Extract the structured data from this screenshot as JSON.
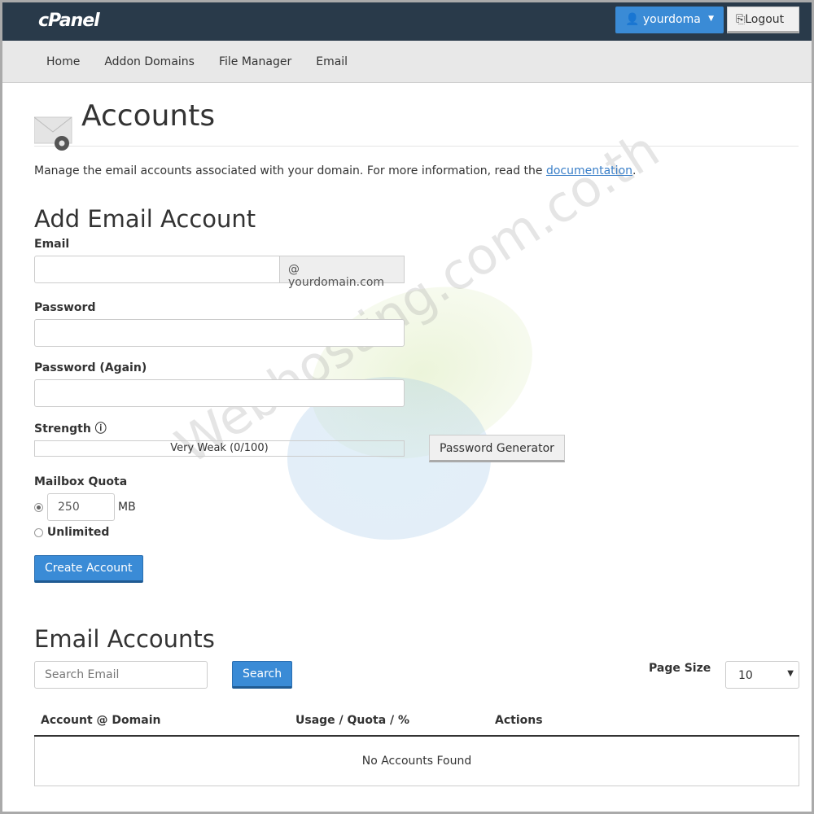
{
  "header": {
    "logo": "cPanel",
    "user_label": "yourdoma",
    "logout_label": "Logout"
  },
  "nav": [
    "Home",
    "Addon Domains",
    "File Manager",
    "Email"
  ],
  "page": {
    "title": "Accounts",
    "description": "Manage the email accounts associated with your domain. For more information, read the ",
    "doc_link": "documentation",
    "desc_end": "."
  },
  "add": {
    "heading": "Add Email Account",
    "email_label": "Email",
    "email_value": "",
    "domain_suffix": "@ yourdomain.com",
    "password_label": "Password",
    "password_again_label": "Password (Again)",
    "strength_label": "Strength",
    "strength_value": "Very Weak (0/100)",
    "strength_percent": 0,
    "generator_label": "Password Generator",
    "quota_label": "Mailbox Quota",
    "quota_value": "250",
    "quota_unit": "MB",
    "unlimited_label": "Unlimited",
    "quota_selected": "limited",
    "create_label": "Create Account"
  },
  "list": {
    "heading": "Email Accounts",
    "search_placeholder": "Search Email",
    "search_label": "Search",
    "page_size_label": "Page Size",
    "page_size_value": "10",
    "columns": [
      "Account @ Domain",
      "Usage / Quota / %",
      "Actions"
    ],
    "empty": "No Accounts Found"
  },
  "watermark": "Webhosting.com.co.th",
  "colors": {
    "topbar": "#293a4a",
    "primary": "#3a8bd6",
    "nav": "#e8e8e8"
  }
}
